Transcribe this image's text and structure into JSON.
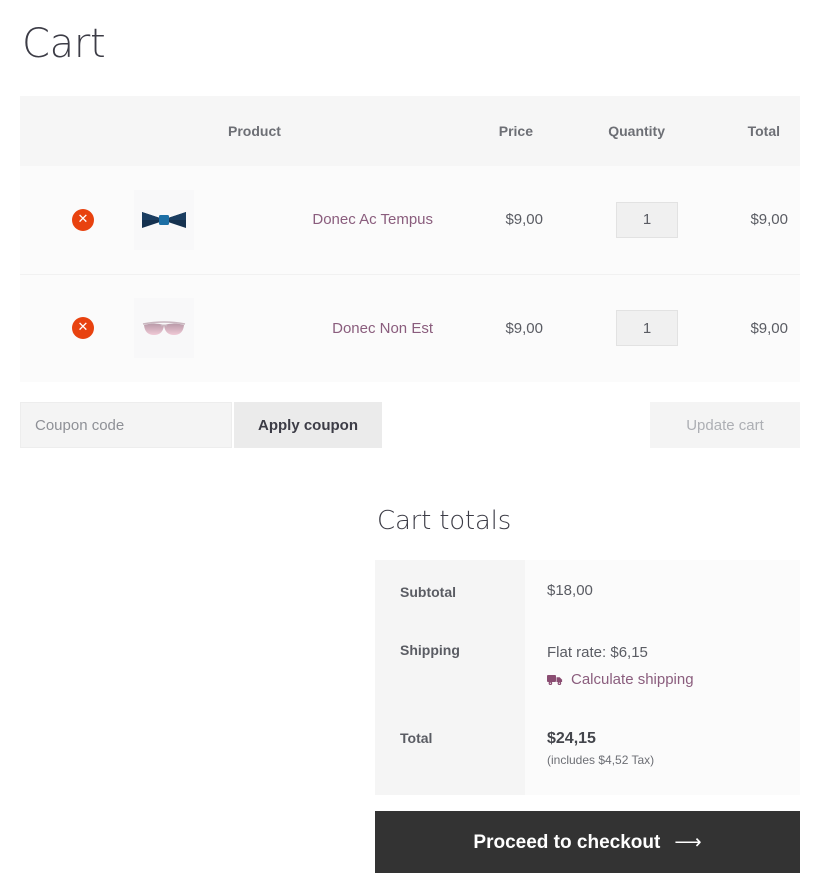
{
  "page": {
    "title": "Cart"
  },
  "cart_table": {
    "columns": {
      "remove": "",
      "thumbnail": "",
      "product": "Product",
      "price": "Price",
      "quantity": "Quantity",
      "total": "Total"
    },
    "remove_icon_label": "✕",
    "rows": [
      {
        "remove_icon": "remove-item-icon",
        "thumbnail_icon": "bow-tie-product-image",
        "name": "Donec Ac Tempus",
        "price": "$9,00",
        "quantity": "1",
        "total": "$9,00"
      },
      {
        "remove_icon": "remove-item-icon",
        "thumbnail_icon": "sunglasses-product-image",
        "name": "Donec Non Est",
        "price": "$9,00",
        "quantity": "1",
        "total": "$9,00"
      }
    ]
  },
  "actions": {
    "coupon_placeholder": "Coupon code",
    "coupon_value": "",
    "apply_coupon_label": "Apply coupon",
    "update_cart_label": "Update cart"
  },
  "totals": {
    "title": "Cart totals",
    "subtotal_label": "Subtotal",
    "subtotal_value": "$18,00",
    "shipping_label": "Shipping",
    "shipping_value": "Flat rate: $6,15",
    "calculate_shipping_label": "Calculate shipping",
    "calculate_shipping_icon": "truck-icon",
    "total_label": "Total",
    "total_value": "$24,15",
    "tax_note": "(includes $4,52 Tax)"
  },
  "checkout": {
    "label": "Proceed to checkout",
    "arrow": "⟶"
  },
  "colors": {
    "link": "#8a5d7d",
    "remove_badge": "#e8420f",
    "checkout_bg": "#333333",
    "header_bg": "#f6f6f6",
    "row_bg": "#fbfbfb"
  }
}
